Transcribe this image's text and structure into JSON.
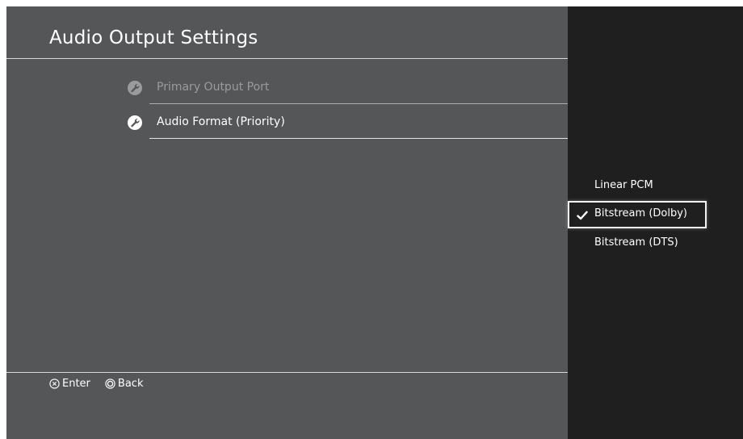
{
  "header": {
    "title": "Audio Output Settings"
  },
  "menu": {
    "items": [
      {
        "label": "Primary Output Port",
        "state": "dimmed",
        "icon": "wrench-icon"
      },
      {
        "label": "Audio Format (Priority)",
        "state": "active",
        "icon": "wrench-icon"
      }
    ]
  },
  "options_panel": {
    "options": [
      {
        "label": "Linear PCM",
        "selected": false
      },
      {
        "label": "Bitstream (Dolby)",
        "selected": true
      },
      {
        "label": "Bitstream (DTS)",
        "selected": false
      }
    ]
  },
  "footer": {
    "enter": {
      "label": "Enter",
      "icon": "cross-button-icon"
    },
    "back": {
      "label": "Back",
      "icon": "circle-button-icon"
    }
  },
  "colors": {
    "background": "#555657",
    "panel": "#1f1f1f",
    "text": "#ffffff",
    "dimmed_text": "#9a9b9c"
  }
}
